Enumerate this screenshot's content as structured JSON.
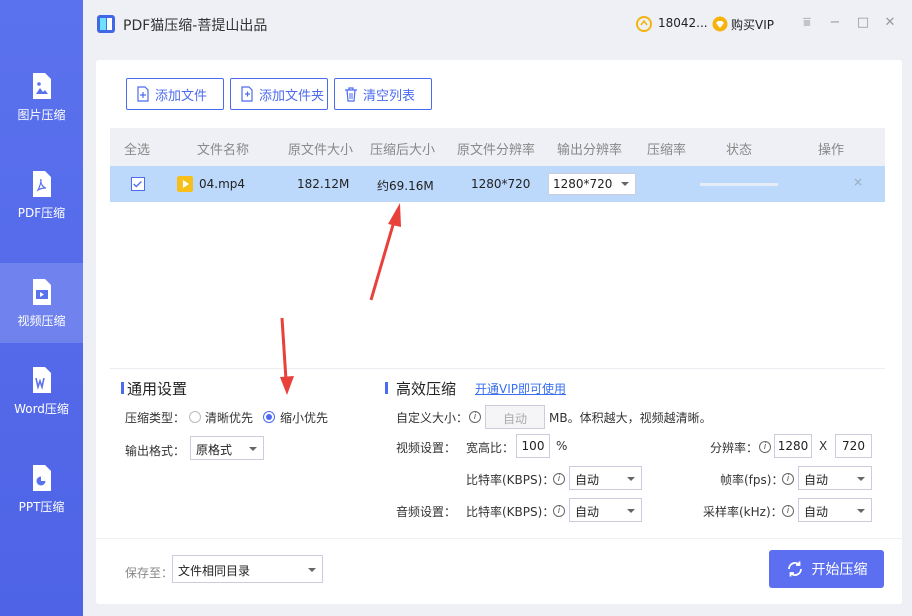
{
  "app": {
    "title": "PDF猫压缩-菩提山出品",
    "coins": "18042...",
    "vip_label": "购买VIP"
  },
  "sidebar": {
    "items": [
      {
        "label": "图片压缩"
      },
      {
        "label": "PDF压缩"
      },
      {
        "label": "视频压缩"
      },
      {
        "label": "Word压缩"
      },
      {
        "label": "PPT压缩"
      }
    ],
    "active_index": 2
  },
  "toolbar": {
    "add_file": "添加文件",
    "add_folder": "添加文件夹",
    "clear_list": "清空列表"
  },
  "table": {
    "headers": [
      "全选",
      "文件名称",
      "原文件大小",
      "压缩后大小",
      "原文件分辨率",
      "输出分辨率",
      "压缩率",
      "状态",
      "操作"
    ],
    "rows": [
      {
        "name": "04.mp4",
        "original_size": "182.12M",
        "compressed_size": "约69.16M",
        "original_resolution": "1280*720",
        "output_resolution": "1280*720",
        "ratio": "",
        "delete": "×"
      }
    ]
  },
  "general": {
    "title": "通用设置",
    "type_label": "压缩类型：",
    "option_clear": "清晰优先",
    "option_small": "缩小优先",
    "format_label": "输出格式：",
    "format_value": "原格式"
  },
  "advanced": {
    "title": "高效压缩",
    "vip_link": "开通VIP即可使用",
    "custom_size_label": "自定义大小：",
    "custom_size_value": "自动",
    "custom_size_hint": "MB。体积越大，视频越清晰。",
    "video_label": "视频设置：",
    "aspect_label": "宽高比：",
    "aspect_value": "100",
    "aspect_unit": "%",
    "resolution_label": "分辨率：",
    "res_width": "1280",
    "res_x": "X",
    "res_height": "720",
    "bitrate_label": "比特率(KBPS)：",
    "bitrate_value": "自动",
    "fps_label": "帧率(fps)：",
    "fps_value": "自动",
    "audio_label": "音频设置：",
    "audio_bitrate_label": "比特率(KBPS)：",
    "audio_bitrate_value": "自动",
    "sample_label": "采样率(kHz)：",
    "sample_value": "自动"
  },
  "footer": {
    "save_label": "保存至：",
    "save_value": "文件相同目录",
    "start_button": "开始压缩"
  },
  "colors": {
    "accent": "#4d6bf0",
    "sidebar": "#5b72ee",
    "selected_row": "#bcd8fb",
    "annotation_arrow": "#e8403a"
  }
}
